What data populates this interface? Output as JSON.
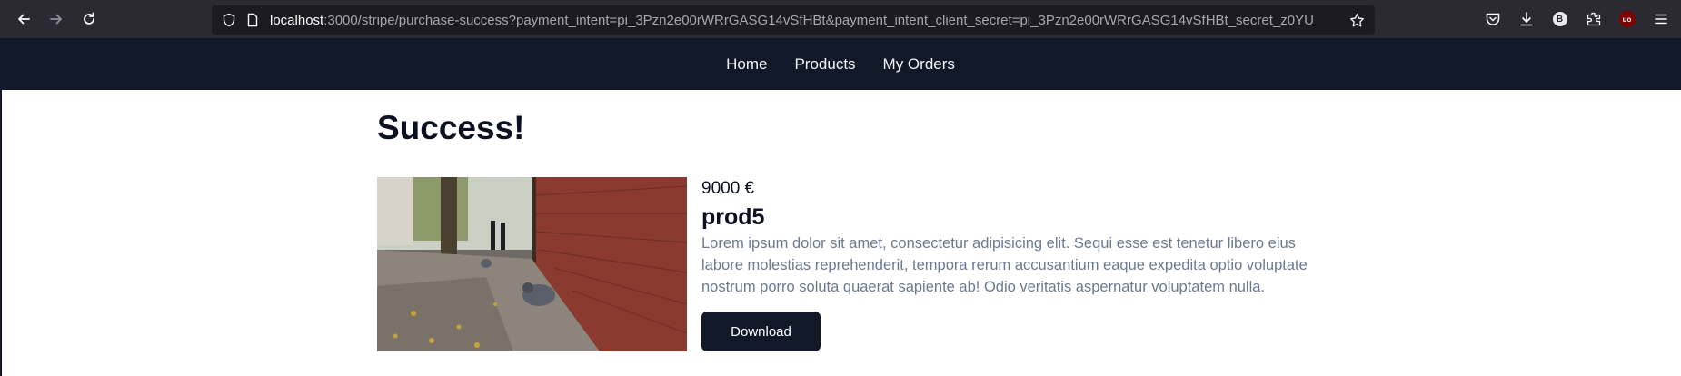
{
  "browser": {
    "url_host": "localhost",
    "url_rest": ":3000/stripe/purchase-success?payment_intent=pi_3Pzn2e00rWRrGASG14vSfHBt&payment_intent_client_secret=pi_3Pzn2e00rWRrGASG14vSfHBt_secret_z0YU",
    "icons": [
      "back-icon",
      "forward-icon",
      "reload-icon",
      "shield-icon",
      "page-icon",
      "bookmark-star-icon",
      "pocket-icon",
      "download-icon",
      "extension-b-icon",
      "extensions-icon",
      "ublock-icon",
      "menu-icon"
    ],
    "ext_b_label": "B",
    "ublock_label": "uo"
  },
  "nav": {
    "items": [
      "Home",
      "Products",
      "My Orders"
    ]
  },
  "main": {
    "title": "Success!",
    "product": {
      "price": "9000 €",
      "name": "prod5",
      "description": "Lorem ipsum dolor sit amet, consectetur adipisicing elit. Sequi esse est tenetur libero eius labore molestias reprehenderit, tempora rerum accusantium eaque expedita optio voluptate nostrum porro soluta quaerat sapiente ab! Odio veritatis aspernatur voluptatem nulla.",
      "download_label": "Download"
    }
  },
  "colors": {
    "chrome_bg": "#2b2a33",
    "nav_bg": "#111827",
    "button_bg": "#111827",
    "desc_text": "#6b7a90"
  }
}
